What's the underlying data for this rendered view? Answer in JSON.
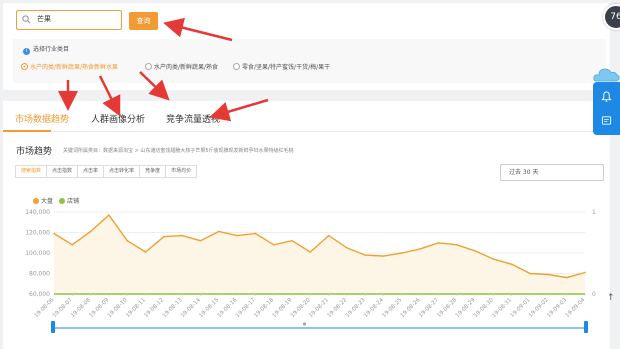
{
  "search": {
    "value": "芒果",
    "button_label": "查询"
  },
  "industry": {
    "label": "选择行业类目",
    "options": [
      "水产肉类/新鲜蔬果/熟食新鲜水果",
      "水产肉类/新鲜蔬果/熟食",
      "零食/坚果/特产蜜饯/干货/梅/果干"
    ],
    "selected_index": 0
  },
  "tabs": [
    "市场数据趋势",
    "人群画像分析",
    "竞争流量透视"
  ],
  "active_tab": 0,
  "section": {
    "title": "市场趋势",
    "subtitle": "关键词所属类目：数据来源淘宝 > 山东潍坊蜜饯甜脆大核子芒果5斤装现摘现发新鲜孕妇水果特级红毛桃"
  },
  "metric_buttons": [
    "搜索指数",
    "点击指数",
    "点击率",
    "点击转化率",
    "竞争度",
    "市场均价"
  ],
  "active_metric": 0,
  "date_range": "过去 30 天",
  "avatar_text": "76",
  "colors": {
    "accent": "#f39a34",
    "series_main": "#f0a030",
    "series_store": "#8bc34a",
    "side_blue": "#1e88e5"
  },
  "icons": [
    "search-icon",
    "info-icon",
    "bell-icon",
    "message-icon",
    "cloud-icon",
    "up-arrow-icon"
  ],
  "chart_data": {
    "type": "line",
    "x": [
      "19-08-06",
      "19-08-07",
      "19-08-08",
      "19-08-09",
      "19-08-10",
      "19-08-11",
      "19-08-12",
      "19-08-13",
      "19-08-14",
      "19-08-15",
      "19-08-16",
      "19-08-17",
      "19-08-18",
      "19-08-19",
      "19-08-20",
      "19-08-21",
      "19-08-22",
      "19-08-23",
      "19-08-24",
      "19-08-25",
      "19-08-26",
      "19-08-27",
      "19-08-28",
      "19-08-29",
      "19-08-30",
      "19-08-31",
      "19-09-01",
      "19-09-02",
      "19-09-03",
      "19-09-04"
    ],
    "series": [
      {
        "name": "大盘",
        "values": [
          119000,
          108000,
          121000,
          137000,
          112000,
          101000,
          116000,
          117000,
          112000,
          121000,
          117000,
          119000,
          108000,
          112000,
          101000,
          117000,
          105000,
          98000,
          97000,
          100000,
          104000,
          110000,
          108000,
          102000,
          94000,
          89000,
          80000,
          79000,
          76000,
          81000
        ]
      },
      {
        "name": "店铺",
        "values": [
          0,
          0,
          0,
          0,
          0,
          0,
          0,
          0,
          0,
          0,
          0,
          0,
          0,
          0,
          0,
          0,
          0,
          0,
          0,
          0,
          0,
          0,
          0,
          0,
          0,
          0,
          0,
          0,
          0,
          0
        ]
      }
    ],
    "y_ticks": [
      "140,000",
      "120,000",
      "100,000",
      "80,000",
      "60,000"
    ],
    "ylim": [
      60000,
      140000
    ],
    "y2_ticks": [
      "1",
      "0"
    ],
    "y2lim": [
      0,
      1
    ],
    "grid": true,
    "legend": "top-left"
  }
}
